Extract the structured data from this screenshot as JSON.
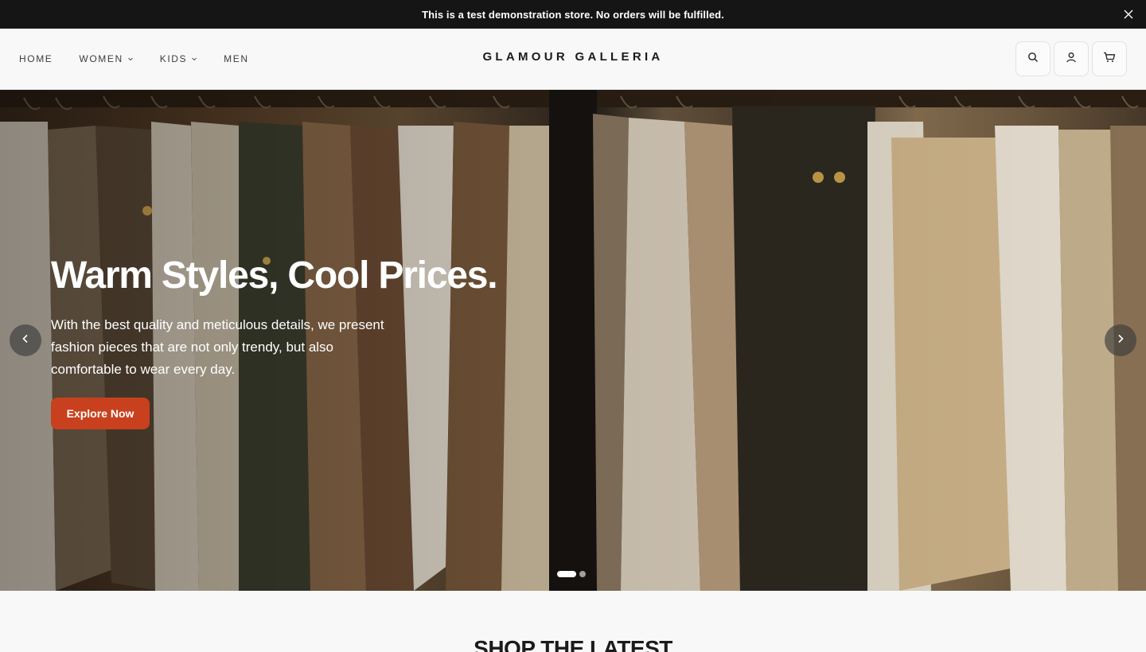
{
  "announcement": {
    "text": "This is a test demonstration store. No orders will be fulfilled.",
    "close_icon": "close-icon"
  },
  "header": {
    "nav": [
      {
        "label": "HOME",
        "has_dropdown": false
      },
      {
        "label": "WOMEN",
        "has_dropdown": true
      },
      {
        "label": "KIDS",
        "has_dropdown": true
      },
      {
        "label": "MEN",
        "has_dropdown": false
      }
    ],
    "logo": "GLAMOUR GALLERIA",
    "icons": [
      "search-icon",
      "account-icon",
      "cart-icon"
    ]
  },
  "hero": {
    "title": "Warm Styles, Cool Prices.",
    "subtitle": "With the best quality and meticulous details, we present fashion pieces that are not only trendy, but also comfortable to wear every day.",
    "cta_label": "Explore Now",
    "slide_count": 2,
    "active_slide": 1
  },
  "section": {
    "title": "SHOP THE LATEST"
  },
  "colors": {
    "announcement_bg": "#151515",
    "cta": "#c8401d",
    "page_bg": "#f8f8f8"
  }
}
